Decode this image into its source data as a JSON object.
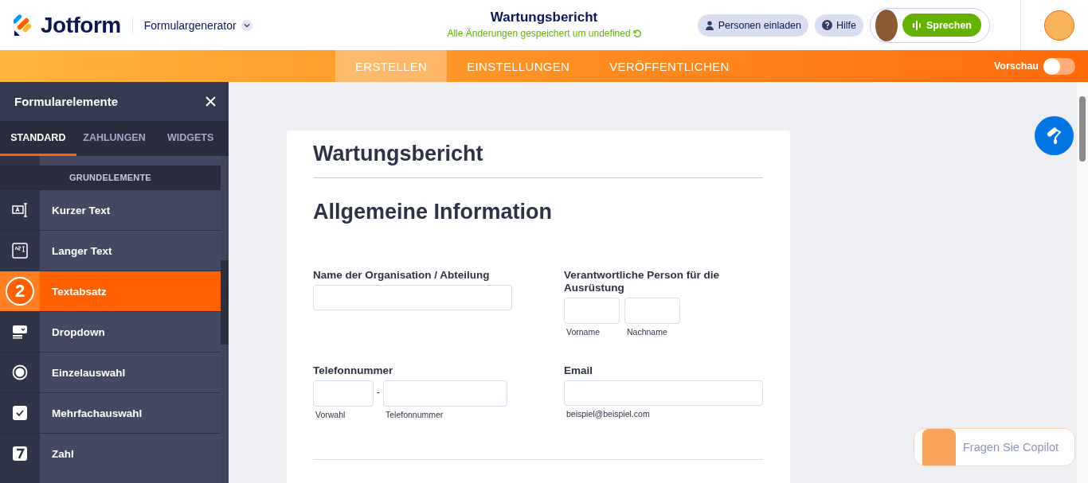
{
  "header": {
    "logo": "Jotform",
    "app_menu": "Formulargenerator",
    "form_title": "Wartungsbericht",
    "save_status": "Alle Änderungen gespeichert um undefined",
    "buttons": [
      {
        "label": "Personen einladen",
        "kind": "invite"
      },
      {
        "label": "Hilfe",
        "kind": "help"
      }
    ],
    "agent_button": "Sprechen"
  },
  "nav": {
    "tabs": [
      {
        "label": "ERSTELLEN",
        "selected": true
      },
      {
        "label": "EINSTELLUNGEN",
        "selected": false
      },
      {
        "label": "VERÖFFENTLICHEN",
        "selected": false
      }
    ],
    "preview": {
      "label": "Vorschau",
      "on": false
    }
  },
  "sidebar": {
    "title": "Formularelemente",
    "tabs": [
      {
        "label": "STANDARD",
        "selected": true
      },
      {
        "label": "ZAHLUNGEN",
        "selected": false
      },
      {
        "label": "WIDGETS",
        "selected": false
      }
    ],
    "section": "GRUNDELEMENTE",
    "items": [
      {
        "label": "Kurzer Text",
        "kind": "short-text",
        "selected": false
      },
      {
        "label": "Langer Text",
        "kind": "long-text",
        "selected": false
      },
      {
        "label": "Textabsatz",
        "selected": true,
        "badge": "2"
      },
      {
        "label": "Dropdown",
        "kind": "dropdown",
        "selected": false
      },
      {
        "label": "Einzelauswahl",
        "kind": "single-choice",
        "selected": false
      },
      {
        "label": "Mehrfachauswahl",
        "kind": "multiple-choice",
        "selected": false
      },
      {
        "label": "Zahl",
        "kind": "number",
        "selected": false
      }
    ]
  },
  "form": {
    "title": "Wartungsbericht",
    "section_heading": "Allgemeine Information",
    "fields": [
      {
        "label": "Name der Organisation / Abteilung",
        "kind": "text"
      },
      {
        "label": "Verantwortliche Person für die Ausrüstung",
        "kind": "name",
        "sublabels": [
          "Vorname",
          "Nachname"
        ]
      },
      {
        "label": "Telefonnummer",
        "kind": "phone",
        "separator": "-",
        "sublabels": [
          "Vorwahl",
          "Telefonnummer"
        ]
      },
      {
        "label": "Email",
        "kind": "email",
        "sublabels": [
          "beispiel@beispiel.com"
        ]
      }
    ]
  },
  "copilot": {
    "label": "Fragen Sie Copilot"
  }
}
